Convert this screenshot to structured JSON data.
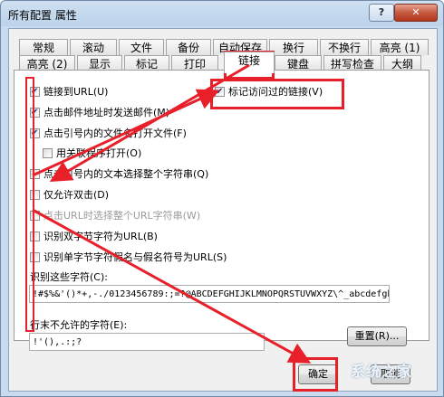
{
  "window": {
    "title": "所有配置 属性",
    "help_label": "?",
    "close_label": "✕"
  },
  "tabs_row1": [
    "常规",
    "滚动",
    "文件",
    "备份",
    "自动保存",
    "换行",
    "不换行",
    "高亮 (1)"
  ],
  "tabs_row2": [
    "高亮 (2)",
    "显示",
    "标记",
    "打印",
    "链接",
    "键盘",
    "拼写检查",
    "大纲"
  ],
  "active_tab": "链接",
  "options": [
    {
      "label": "链接到URL(U)",
      "checked": true,
      "enabled": true
    },
    {
      "label": "点击邮件地址时发送邮件(M)",
      "checked": true,
      "enabled": true
    },
    {
      "label": "点击引号内的文件名打开文件(F)",
      "checked": true,
      "enabled": true
    },
    {
      "label": "用关联程序打开(O)",
      "checked": false,
      "enabled": true
    },
    {
      "label": "点击引号内的文本选择整个字符串(Q)",
      "checked": false,
      "enabled": true
    },
    {
      "label": "仅允许双击(D)",
      "checked": false,
      "enabled": true
    },
    {
      "label": "点击URL时选择整个URL字符串(W)",
      "checked": false,
      "enabled": false
    },
    {
      "label": "识别双字节字符为URL(B)",
      "checked": false,
      "enabled": true
    },
    {
      "label": "识别单字节字符假名与假名符号为URL(S)",
      "checked": false,
      "enabled": true
    }
  ],
  "visited_link": {
    "label": "标记访问过的链接(V)",
    "checked": true
  },
  "recognize_chars": {
    "label": "识别这些字符(C):",
    "value": "!#$%&'()*+,-./0123456789:;=?@ABCDEFGHIJKLMNOPQRSTUVWXYZ\\^_abcdefghijklmnopqrstuvwxyz{|}~"
  },
  "end_chars": {
    "label": "行末不允许的字符(E):",
    "value": "!'(),.:;?"
  },
  "buttons": {
    "reset": "重置(R)...",
    "ok": "确定",
    "cancel": "取消"
  },
  "watermark": "系统之家",
  "colors": {
    "annotation": "#e8202a",
    "accent": "#1d3c7a"
  }
}
